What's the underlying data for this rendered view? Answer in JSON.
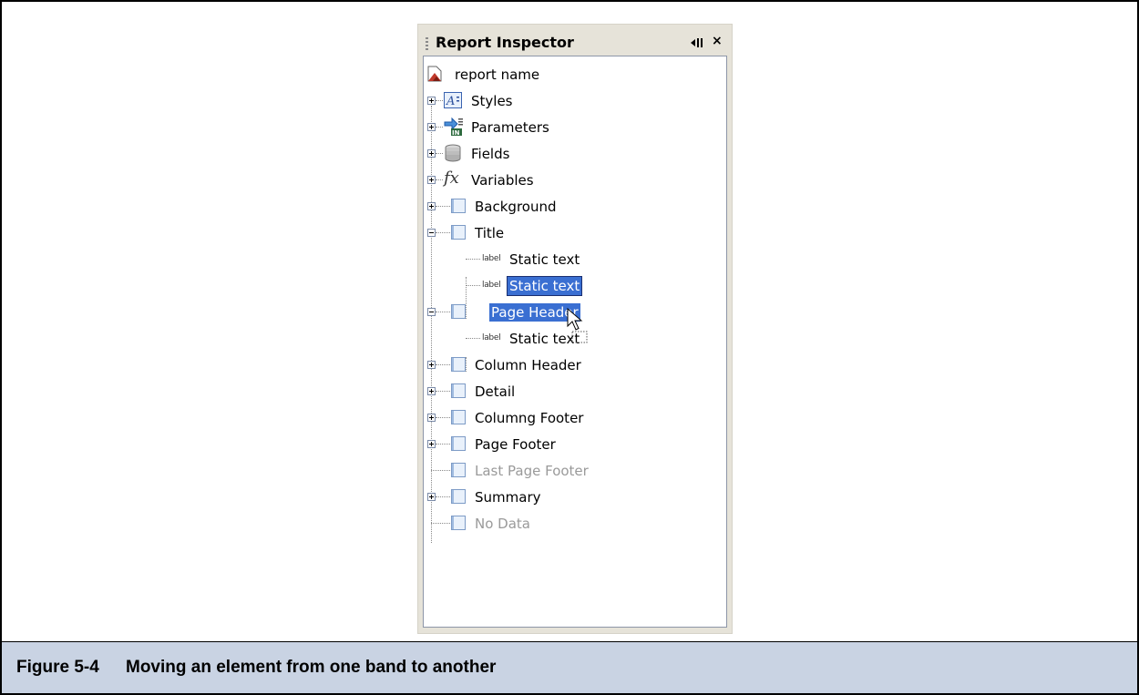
{
  "panel": {
    "title": "Report Inspector",
    "root_label": "report name"
  },
  "tree": {
    "styles": "Styles",
    "parameters": "Parameters",
    "fields": "Fields",
    "variables": "Variables",
    "background": "Background",
    "title": "Title",
    "title_children": [
      "Static text",
      "Static text"
    ],
    "page_header": "Page Header",
    "page_header_children": [
      "Static text"
    ],
    "column_header": "Column Header",
    "detail": "Detail",
    "column_footer": "Columng Footer",
    "page_footer": "Page Footer",
    "last_page_footer": "Last Page Footer",
    "summary": "Summary",
    "no_data": "No Data",
    "label_icon_text": "label",
    "fx_icon_text": "fx"
  },
  "caption": {
    "number": "Figure 5-4",
    "text": "Moving an element from one band to another"
  },
  "colors": {
    "selection": "#3a6fd2",
    "caption_bg": "#c9d3e3",
    "panel_bg": "#e6e3d9",
    "disabled_text": "#9a9a9a"
  },
  "icons": {
    "root": "report-icon",
    "styles": "styles-icon",
    "parameters": "parameters-icon",
    "fields": "fields-icon",
    "variables": "fx-icon",
    "band": "band-icon",
    "element": "label-icon",
    "minimize": "minimize-icon",
    "close": "close-icon",
    "pointer": "mouse-pointer-icon"
  }
}
